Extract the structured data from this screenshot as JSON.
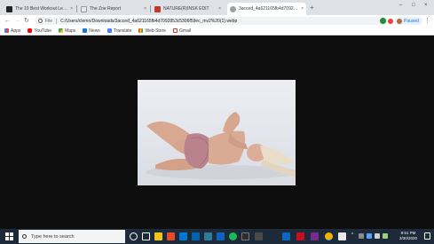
{
  "browser": {
    "tabs": [
      {
        "label": "The 10 Best Workout Leggings",
        "favicon": "tab-favicon-dark",
        "active": false
      },
      {
        "label": "The Zoe Report",
        "favicon": "tab-favicon-zoe",
        "active": false
      },
      {
        "label": "NATURE(R)INSK EDIT",
        "favicon": "tab-favicon-red",
        "active": false
      },
      {
        "label": "3acced_4a621165fb4d7092853",
        "favicon": "tab-favicon-globe",
        "active": true
      }
    ],
    "new_tab_label": "+",
    "window_controls": {
      "minimize": "–",
      "maximize": "□",
      "close": "×"
    },
    "tab_close_glyph": "×"
  },
  "toolbar": {
    "back": "←",
    "forward": "→",
    "reload": "↻",
    "address_scheme": "File",
    "address_url": "C:/Users/clemn/Downloads/3acced_4a621165fb4d7092853c5306f59ec_mv2%20(1).webp",
    "star": "☆",
    "profile_label": "Paused",
    "menu": "⋮",
    "extension_colors": [
      "#1e8e3e",
      "#ea4335"
    ]
  },
  "bookmarks": [
    {
      "label": "Apps",
      "icon": "apps-icon",
      "color": "#4285f4"
    },
    {
      "label": "YouTube",
      "icon": "youtube-icon",
      "color": "#ff0000"
    },
    {
      "label": "Maps",
      "icon": "maps-icon",
      "color": "#34a853"
    },
    {
      "label": "News",
      "icon": "news-icon",
      "color": "#1a73e8"
    },
    {
      "label": "Translate",
      "icon": "translate-icon",
      "color": "#4285f4"
    },
    {
      "label": "Web Store",
      "icon": "webstore-icon",
      "color": "#ea4335"
    },
    {
      "label": "Gmail",
      "icon": "gmail-icon",
      "color": "#d93025"
    }
  ],
  "taskbar": {
    "search_placeholder": "Type here to search",
    "pinned_icon_colors": [
      "#ffffff",
      "#f0c419",
      "#e34c26",
      "#0078d4",
      "#1db954",
      "#2d2d2d",
      "#0a66c2",
      "#c50f1f",
      "#7a2a8c",
      "#f4b400",
      "#1e88e5"
    ],
    "tray_caret": "^",
    "time": "8:51 PM",
    "date": "3/30/2020"
  }
}
